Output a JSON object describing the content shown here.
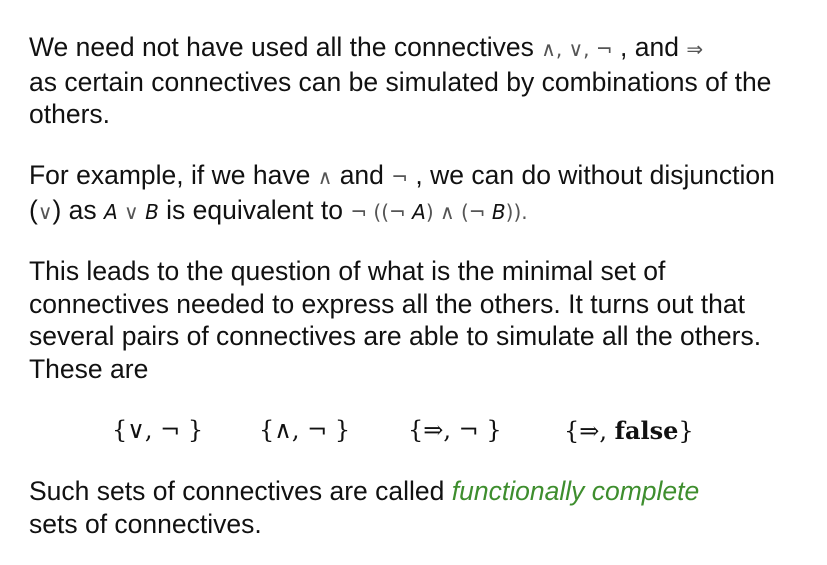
{
  "p1": {
    "t1": "We need not have used all the connectives ",
    "s1": "∧, ∨, ¬",
    "t2": " , and ",
    "s2": "⇒",
    "t3": "as certain connectives can be simulated by combinations of the others."
  },
  "p2": {
    "t1": "For example, if we have ",
    "s1": "∧",
    "t2": " and ",
    "s2": "¬",
    "t3": " , we can do without disjunction (",
    "s3": "∨",
    "t4": ") as ",
    "v1": "A",
    "s4": " ∨ ",
    "v2": "B",
    "t5": " is equivalent to ",
    "s5": "¬ ((¬ ",
    "v3": "A",
    "s6": ") ∧ (¬ ",
    "v4": "B",
    "s7": "))."
  },
  "p3": "This leads to the question of what is the minimal set of connectives needed to express all the others. It turns out that several pairs of connectives are able to simulate all the others. These are",
  "sets": [
    {
      "text": "{∨, ¬ }"
    },
    {
      "text": "{∧, ¬ }"
    },
    {
      "text": "{⇒, ¬ }"
    },
    {
      "prefix": "{⇒, ",
      "bold": "false",
      "suffix": "}"
    }
  ],
  "p4": {
    "t1": "Such sets of connectives are called ",
    "highlight": "functionally complete",
    "t2": "sets of connectives."
  },
  "colors": {
    "highlight": "#3e8e2e",
    "symbols": "#555555"
  }
}
